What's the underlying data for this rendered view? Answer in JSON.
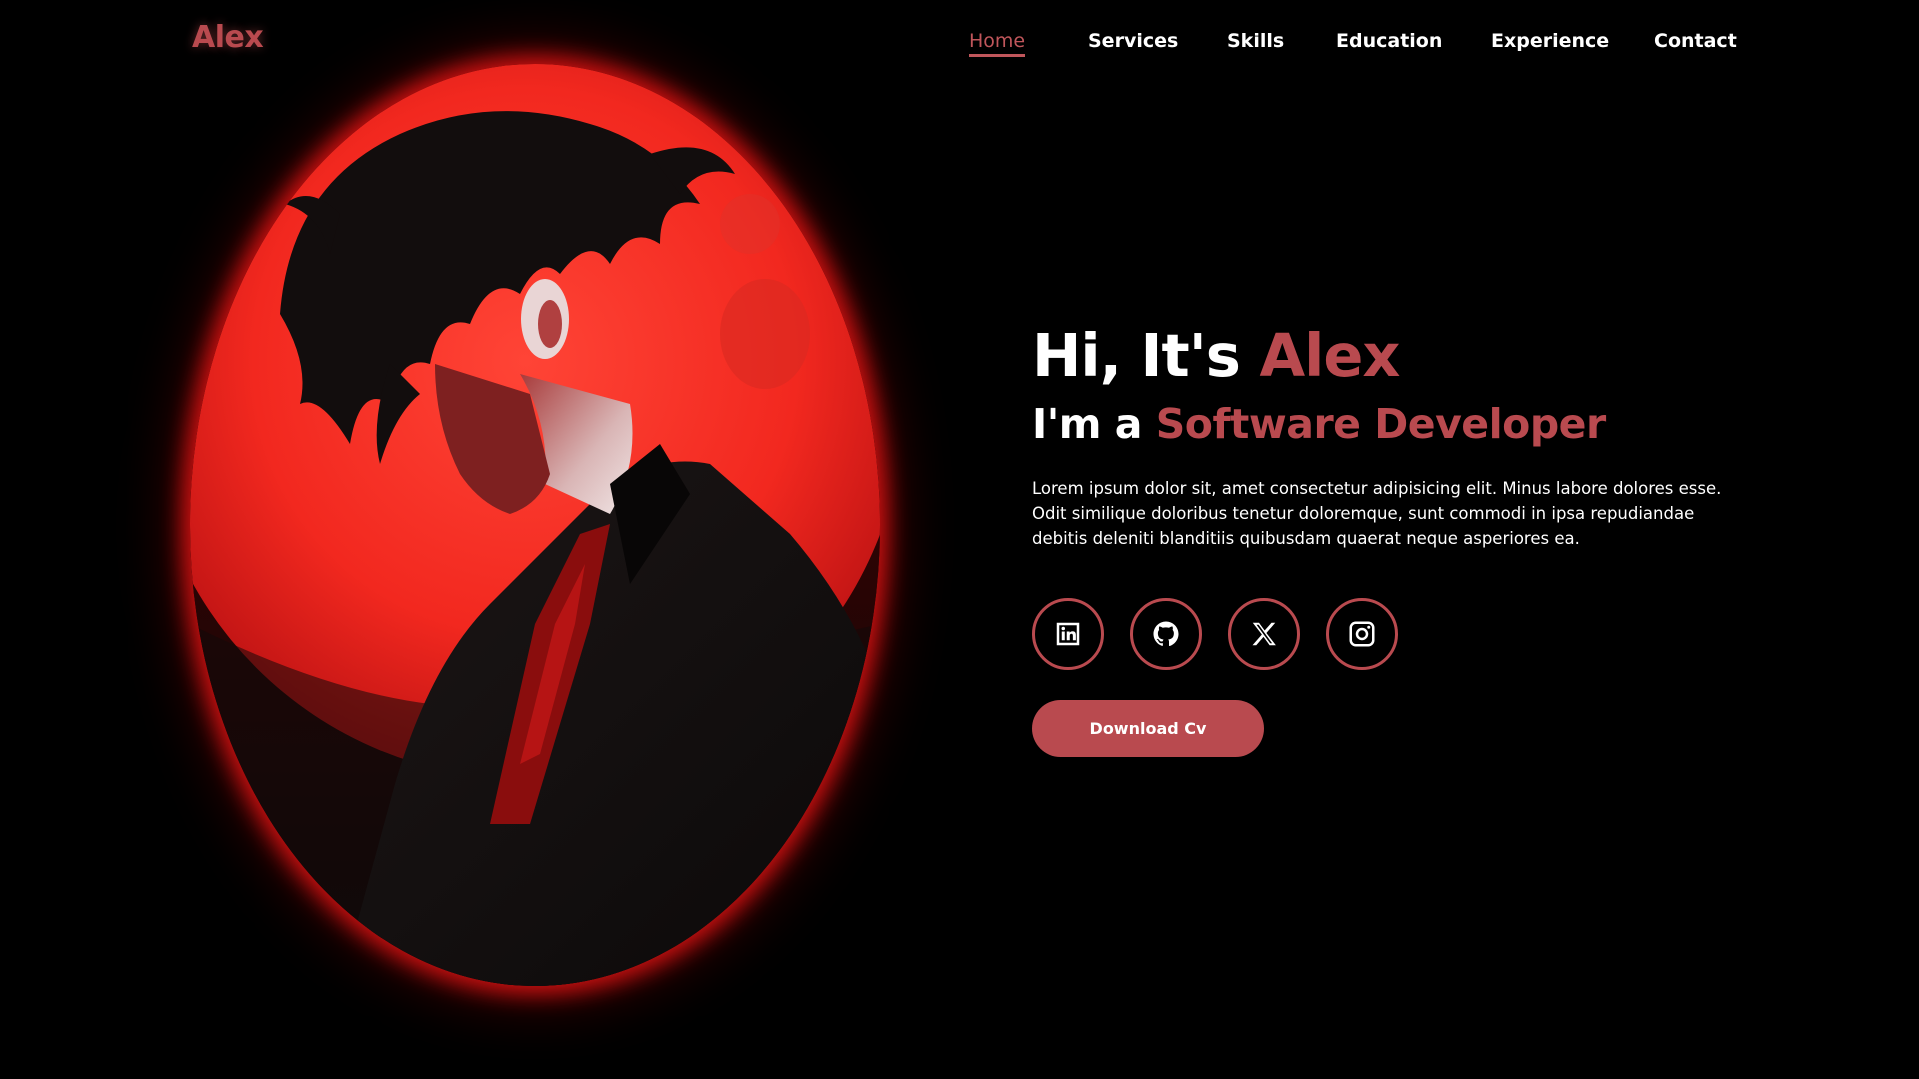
{
  "header": {
    "logo": "Alex",
    "nav": [
      {
        "label": "Home",
        "active": true
      },
      {
        "label": "Services",
        "active": false
      },
      {
        "label": "Skills",
        "active": false
      },
      {
        "label": "Education",
        "active": false
      },
      {
        "label": "Experience",
        "active": false
      },
      {
        "label": "Contact",
        "active": false
      }
    ]
  },
  "hero": {
    "greeting_prefix": "Hi, It's",
    "greeting_name": "Alex",
    "role_prefix": "I'm a",
    "role_title": "Software Developer",
    "description": "Lorem ipsum dolor sit, amet consectetur adipisicing elit. Minus labore dolores esse. Odit similique doloribus tenetur doloremque, sunt commodi in ipsa repudiandae debitis deleniti blanditiis quibusdam quaerat neque asperiores ea.",
    "socials": [
      {
        "icon": "linkedin-icon"
      },
      {
        "icon": "github-icon"
      },
      {
        "icon": "x-icon"
      },
      {
        "icon": "instagram-icon"
      }
    ],
    "download_label": "Download Cv",
    "image_icon": "profile-illustration"
  },
  "colors": {
    "background": "#000000",
    "accent": "#b94a4f",
    "glow": "#e61414",
    "text": "#ffffff"
  }
}
